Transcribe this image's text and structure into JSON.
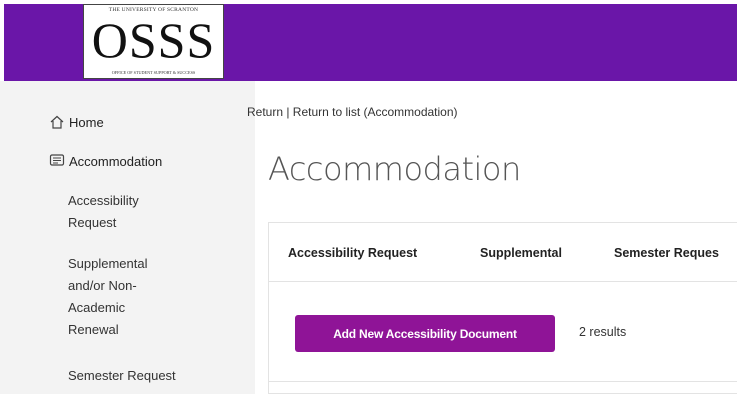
{
  "header": {
    "logo": {
      "top_text": "THE UNIVERSITY OF SCRANTON",
      "main_text": "OSSS",
      "bottom_text": "OFFICE OF STUDENT SUPPORT & SUCCESS"
    },
    "bar_color": "#6a16a8"
  },
  "sidebar": {
    "items": [
      {
        "label": "Home",
        "icon": "home-icon"
      },
      {
        "label": "Accommodation",
        "icon": "message-icon"
      }
    ],
    "sub_items": [
      {
        "label": "Accessibility Request"
      },
      {
        "label": "Supplemental and/or Non-Academic Renewal"
      },
      {
        "label": "Semester Request"
      }
    ]
  },
  "breadcrumb": {
    "text": "Return | Return to list (Accommodation)"
  },
  "main": {
    "title": "Accommodation",
    "tabs": [
      {
        "label": "Accessibility Request"
      },
      {
        "label": "Supplemental"
      },
      {
        "label": "Semester Reques"
      }
    ],
    "add_button_label": "Add New Accessibility Document",
    "add_button_color": "#8f1497",
    "results_text": "2 results"
  }
}
